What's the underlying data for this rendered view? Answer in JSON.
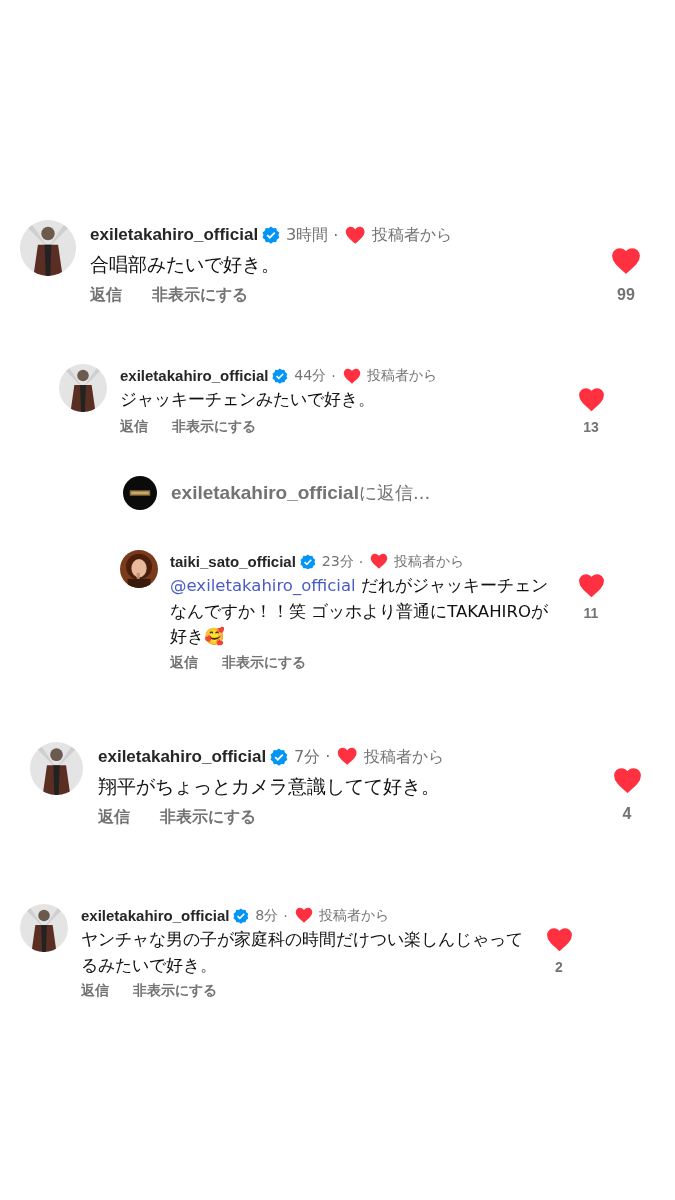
{
  "comments": [
    {
      "kind": "comment",
      "username": "exiletakahiro_official",
      "verified": true,
      "time": "3時間",
      "separator": "·",
      "author_liked": true,
      "author_label": "投稿者から",
      "text": "合唱部みたいで好き。",
      "actions": [
        "返信",
        "非表示にする"
      ],
      "liked": true,
      "like_count": "99"
    },
    {
      "kind": "comment",
      "username": "exiletakahiro_official",
      "verified": true,
      "time": "44分",
      "separator": "·",
      "author_liked": true,
      "author_label": "投稿者から",
      "text": "ジャッキーチェンみたいで好き。",
      "actions": [
        "返信",
        "非表示にする"
      ],
      "liked": true,
      "like_count": "13"
    },
    {
      "kind": "reply_prompt",
      "username": "exiletakahiro_official",
      "suffix": "に返信..."
    },
    {
      "kind": "comment",
      "username": "taiki_sato_official",
      "verified": true,
      "time": "23分",
      "separator": "·",
      "author_liked": true,
      "author_label": "投稿者から",
      "mention": "@exiletakahiro_official",
      "text": "だれがジャッキーチェンなんですか！！笑 ゴッホより普通にTAKAHIROが好き🥰",
      "actions": [
        "返信",
        "非表示にする"
      ],
      "liked": true,
      "like_count": "11"
    },
    {
      "kind": "comment",
      "username": "exiletakahiro_official",
      "verified": true,
      "time": "7分",
      "separator": "·",
      "author_liked": true,
      "author_label": "投稿者から",
      "text": "翔平がちょっとカメラ意識してて好き。",
      "actions": [
        "返信",
        "非表示にする"
      ],
      "liked": true,
      "like_count": "4"
    },
    {
      "kind": "comment",
      "username": "exiletakahiro_official",
      "verified": true,
      "time": "8分",
      "separator": "·",
      "author_liked": true,
      "author_label": "投稿者から",
      "text": "ヤンチャな男の子が家庭科の時間だけつい楽しんじゃってるみたいで好き。",
      "actions": [
        "返信",
        "非表示にする"
      ],
      "liked": true,
      "like_count": "2"
    }
  ]
}
